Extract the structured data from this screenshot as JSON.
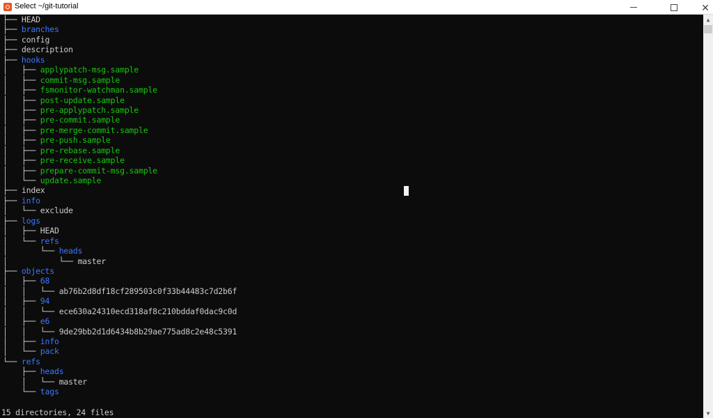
{
  "window": {
    "title": "Select ~/git-tutorial",
    "app_icon": "ubuntu-terminal-icon",
    "controls": {
      "minimize": "minimize",
      "maximize": "maximize",
      "close": "close"
    }
  },
  "colors": {
    "background": "#0c0c0c",
    "file": "#cccccc",
    "directory": "#3b78ff",
    "executable": "#16c60c"
  },
  "tree": [
    {
      "prefix": "├── ",
      "name": "HEAD",
      "type": "file"
    },
    {
      "prefix": "├── ",
      "name": "branches",
      "type": "dir"
    },
    {
      "prefix": "├── ",
      "name": "config",
      "type": "file"
    },
    {
      "prefix": "├── ",
      "name": "description",
      "type": "file"
    },
    {
      "prefix": "├── ",
      "name": "hooks",
      "type": "dir"
    },
    {
      "prefix": "│   ├── ",
      "name": "applypatch-msg.sample",
      "type": "exec"
    },
    {
      "prefix": "│   ├── ",
      "name": "commit-msg.sample",
      "type": "exec"
    },
    {
      "prefix": "│   ├── ",
      "name": "fsmonitor-watchman.sample",
      "type": "exec"
    },
    {
      "prefix": "│   ├── ",
      "name": "post-update.sample",
      "type": "exec"
    },
    {
      "prefix": "│   ├── ",
      "name": "pre-applypatch.sample",
      "type": "exec"
    },
    {
      "prefix": "│   ├── ",
      "name": "pre-commit.sample",
      "type": "exec"
    },
    {
      "prefix": "│   ├── ",
      "name": "pre-merge-commit.sample",
      "type": "exec"
    },
    {
      "prefix": "│   ├── ",
      "name": "pre-push.sample",
      "type": "exec"
    },
    {
      "prefix": "│   ├── ",
      "name": "pre-rebase.sample",
      "type": "exec"
    },
    {
      "prefix": "│   ├── ",
      "name": "pre-receive.sample",
      "type": "exec"
    },
    {
      "prefix": "│   ├── ",
      "name": "prepare-commit-msg.sample",
      "type": "exec"
    },
    {
      "prefix": "│   └── ",
      "name": "update.sample",
      "type": "exec"
    },
    {
      "prefix": "├── ",
      "name": "index",
      "type": "file"
    },
    {
      "prefix": "├── ",
      "name": "info",
      "type": "dir"
    },
    {
      "prefix": "│   └── ",
      "name": "exclude",
      "type": "file"
    },
    {
      "prefix": "├── ",
      "name": "logs",
      "type": "dir"
    },
    {
      "prefix": "│   ├── ",
      "name": "HEAD",
      "type": "file"
    },
    {
      "prefix": "│   └── ",
      "name": "refs",
      "type": "dir"
    },
    {
      "prefix": "│       └── ",
      "name": "heads",
      "type": "dir"
    },
    {
      "prefix": "│           └── ",
      "name": "master",
      "type": "file"
    },
    {
      "prefix": "├── ",
      "name": "objects",
      "type": "dir"
    },
    {
      "prefix": "│   ├── ",
      "name": "68",
      "type": "dir"
    },
    {
      "prefix": "│   │   └── ",
      "name": "ab76b2d8df18cf289503c0f33b44483c7d2b6f",
      "type": "file"
    },
    {
      "prefix": "│   ├── ",
      "name": "94",
      "type": "dir"
    },
    {
      "prefix": "│   │   └── ",
      "name": "ece630a24310ecd318af8c210bddaf0dac9c0d",
      "type": "file"
    },
    {
      "prefix": "│   ├── ",
      "name": "e6",
      "type": "dir"
    },
    {
      "prefix": "│   │   └── ",
      "name": "9de29bb2d1d6434b8b29ae775ad8c2e48c5391",
      "type": "file"
    },
    {
      "prefix": "│   ├── ",
      "name": "info",
      "type": "dir"
    },
    {
      "prefix": "│   └── ",
      "name": "pack",
      "type": "dir"
    },
    {
      "prefix": "└── ",
      "name": "refs",
      "type": "dir"
    },
    {
      "prefix": "    ├── ",
      "name": "heads",
      "type": "dir"
    },
    {
      "prefix": "    │   └── ",
      "name": "master",
      "type": "file"
    },
    {
      "prefix": "    └── ",
      "name": "tags",
      "type": "dir"
    },
    {
      "prefix": "",
      "name": "",
      "type": "blank"
    }
  ],
  "summary": "15 directories, 24 files"
}
